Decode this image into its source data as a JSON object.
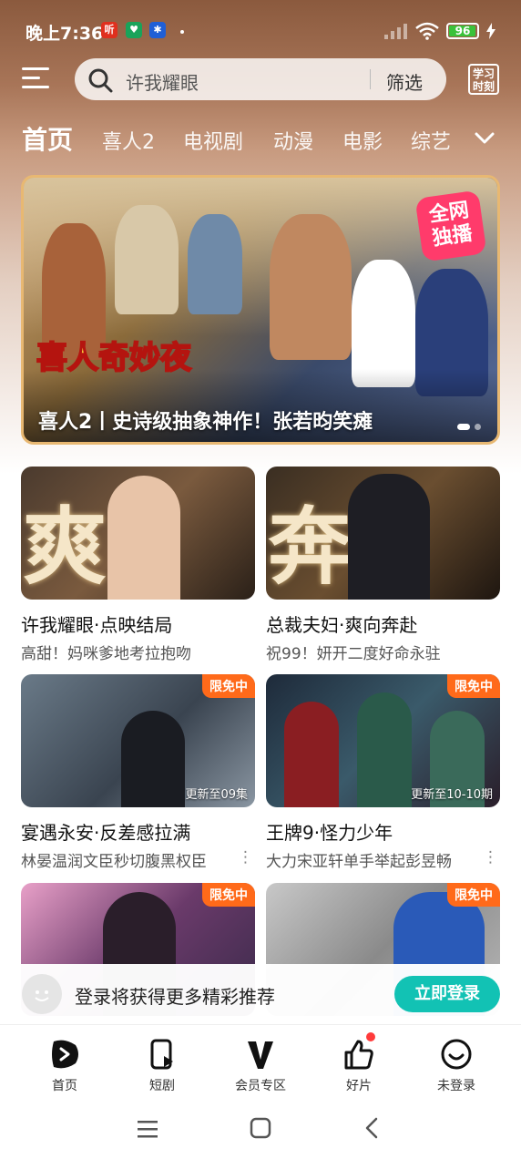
{
  "status_bar": {
    "time": "晚上7:36",
    "badges": [
      {
        "label": "听",
        "color": "#e0301e"
      },
      {
        "label": "♥",
        "color": "#19a35a"
      },
      {
        "label": "✱",
        "color": "#1f5fd6"
      }
    ],
    "battery_level": "96"
  },
  "header": {
    "search_placeholder": "许我耀眼",
    "filter_label": "筛选",
    "study_label_top": "学习",
    "study_label_bottom": "时刻"
  },
  "tabs": [
    {
      "label": "首页",
      "active": true
    },
    {
      "label": "喜人2"
    },
    {
      "label": "电视剧"
    },
    {
      "label": "动漫"
    },
    {
      "label": "电影"
    },
    {
      "label": "综艺"
    }
  ],
  "banner": {
    "caption": "喜人2丨史诗级抽象神作！张若昀笑瘫",
    "logo_text": "喜人奇妙夜",
    "badge_line1": "全网",
    "badge_line2": "独播"
  },
  "cards": [
    {
      "title": "许我耀眼·点映结局",
      "subtitle": "高甜！妈咪爹地考拉抱吻",
      "art": "爽向",
      "free": "",
      "episodes": "",
      "more": ""
    },
    {
      "title": "总裁夫妇·爽向奔赴",
      "subtitle": "祝99！妍开二度好命永驻",
      "art": "奔赴",
      "free": "",
      "episodes": "",
      "more": ""
    },
    {
      "title": "宴遇永安·反差感拉满",
      "subtitle": "林晏温润文臣秒切腹黑权臣",
      "art": "",
      "free": "限免中",
      "episodes": "更新至09集",
      "more": "⋮"
    },
    {
      "title": "王牌9·怪力少年",
      "subtitle": "大力宋亚轩单手举起彭昱畅",
      "art": "",
      "free": "限免中",
      "episodes": "更新至10-10期",
      "more": "⋮"
    },
    {
      "title": "",
      "subtitle": "",
      "art": "",
      "free": "限免中",
      "episodes": "",
      "more": ""
    },
    {
      "title": "",
      "subtitle": "",
      "art": "",
      "free": "限免中",
      "episodes": "",
      "more": ""
    }
  ],
  "login_bar": {
    "text": "登录将获得更多精彩推荐",
    "button": "立即登录"
  },
  "bottom_nav": [
    {
      "label": "首页",
      "icon": "home-play-icon"
    },
    {
      "label": "短剧",
      "icon": "short-drama-icon"
    },
    {
      "label": "会员专区",
      "icon": "vip-v-icon"
    },
    {
      "label": "好片",
      "icon": "thumbs-up-icon"
    },
    {
      "label": "未登录",
      "icon": "user-smile-icon"
    }
  ],
  "colors": {
    "accent": "#12c2b4",
    "free_badge": "#ff6a1a"
  }
}
